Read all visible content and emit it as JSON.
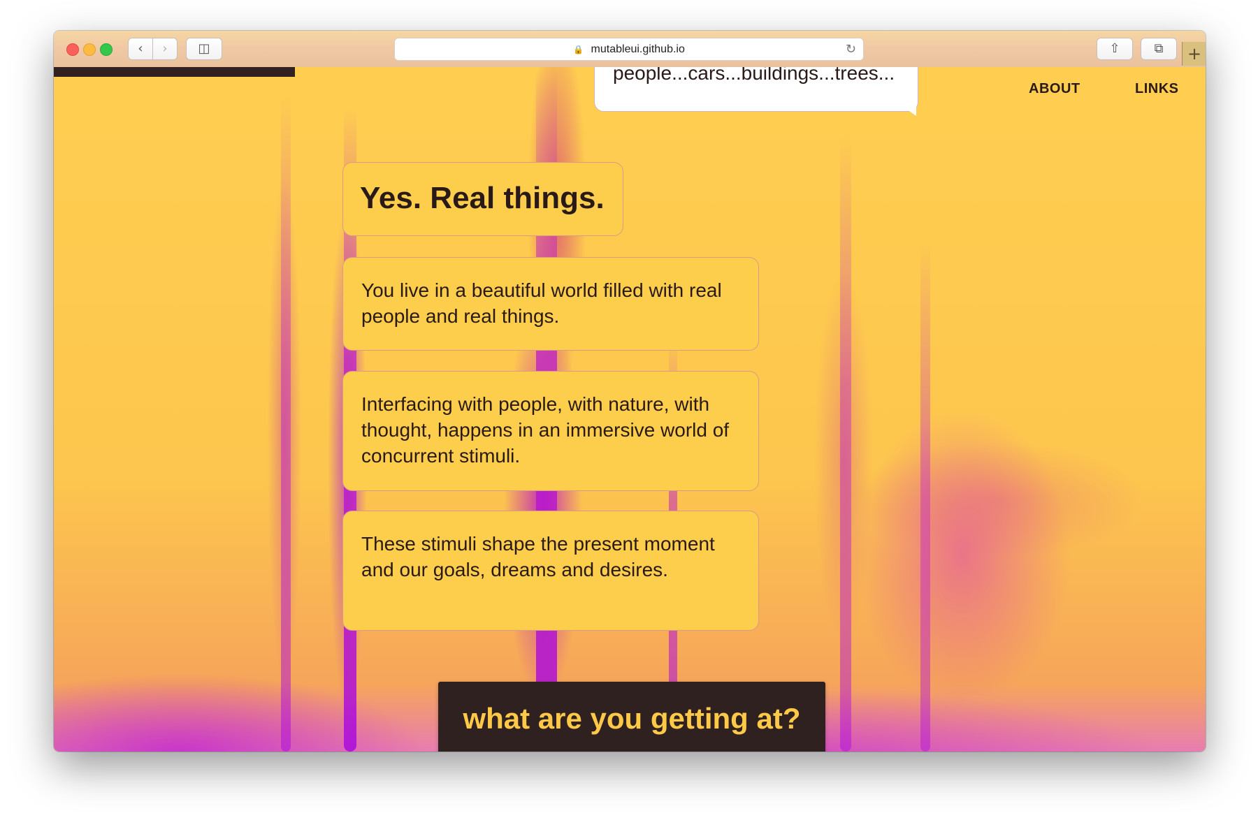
{
  "browser": {
    "url": "mutableui.github.io",
    "icons": {
      "back": "chevron-left-icon",
      "forward": "chevron-right-icon",
      "sidebar": "sidebar-icon",
      "share": "share-icon",
      "tabs": "tabs-icon",
      "new_tab": "plus-icon",
      "lock": "lock-icon",
      "reload": "reload-icon"
    }
  },
  "nav": {
    "about": "ABOUT",
    "links": "LINKS"
  },
  "speech_bubble": {
    "text": "people...cars...buildings...trees..."
  },
  "cards": {
    "title": "Yes. Real things.",
    "items": [
      "You live in a beautiful world filled with real people and real things.",
      "Interfacing with people, with nature, with thought, happens in an immersive world of concurrent stimuli.",
      "These stimuli shape the present moment and our goals, dreams and desires."
    ]
  },
  "cta": {
    "label": "what are you getting at?"
  },
  "colors": {
    "background": "#fdc64e",
    "card": "#fdcd4c",
    "dark": "#2f2120",
    "cta_text": "#ffc948"
  }
}
